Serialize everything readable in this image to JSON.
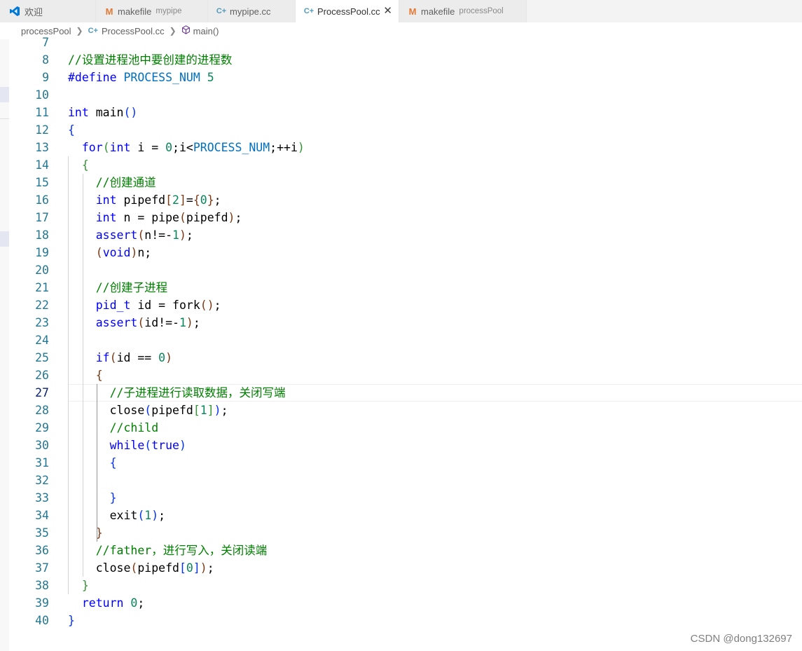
{
  "tabs": [
    {
      "label": "欢迎",
      "description": "",
      "icon": "vscode-icon",
      "active": false
    },
    {
      "label": "makefile",
      "description": "mypipe",
      "icon": "makefile-icon",
      "active": false
    },
    {
      "label": "mypipe.cc",
      "description": "",
      "icon": "cpp-file-icon",
      "active": false
    },
    {
      "label": "ProcessPool.cc",
      "description": "",
      "icon": "cpp-file-icon",
      "active": true
    },
    {
      "label": "makefile",
      "description": "processPool",
      "icon": "makefile-icon",
      "active": false
    }
  ],
  "breadcrumb": {
    "folder": "processPool",
    "file": "ProcessPool.cc",
    "symbol": "main()"
  },
  "editor": {
    "current_line": 27,
    "lines": [
      {
        "n": "7",
        "tokens": []
      },
      {
        "n": "8",
        "tokens": [
          [
            "cm",
            "//设置进程池中要创建的进程数"
          ]
        ]
      },
      {
        "n": "9",
        "tokens": [
          [
            "pp",
            "#define"
          ],
          [
            "",
            " "
          ],
          [
            "mc",
            "PROCESS_NUM"
          ],
          [
            "",
            " "
          ],
          [
            "nm",
            "5"
          ]
        ]
      },
      {
        "n": "10",
        "tokens": []
      },
      {
        "n": "11",
        "tokens": [
          [
            "kw",
            "int"
          ],
          [
            "",
            " main"
          ],
          [
            "b1",
            "()"
          ]
        ]
      },
      {
        "n": "12",
        "tokens": [
          [
            "b1",
            "{"
          ]
        ]
      },
      {
        "n": "13",
        "tokens": [
          [
            "",
            "  "
          ],
          [
            "kw",
            "for"
          ],
          [
            "b2",
            "("
          ],
          [
            "kw",
            "int"
          ],
          [
            "",
            " i = "
          ],
          [
            "nm",
            "0"
          ],
          [
            "",
            ";i<"
          ],
          [
            "mc",
            "PROCESS_NUM"
          ],
          [
            "",
            ";++i"
          ],
          [
            "b2",
            ")"
          ]
        ]
      },
      {
        "n": "14",
        "tokens": [
          [
            "",
            "  "
          ],
          [
            "b2",
            "{"
          ]
        ]
      },
      {
        "n": "15",
        "tokens": [
          [
            "",
            "    "
          ],
          [
            "cm",
            "//创建通道"
          ]
        ]
      },
      {
        "n": "16",
        "tokens": [
          [
            "",
            "    "
          ],
          [
            "kw",
            "int"
          ],
          [
            "",
            " pipefd"
          ],
          [
            "b3",
            "["
          ],
          [
            "nm",
            "2"
          ],
          [
            "b3",
            "]"
          ],
          [
            "",
            "="
          ],
          [
            "b3",
            "{"
          ],
          [
            "nm",
            "0"
          ],
          [
            "b3",
            "}"
          ],
          [
            "",
            ";"
          ]
        ]
      },
      {
        "n": "17",
        "tokens": [
          [
            "",
            "    "
          ],
          [
            "kw",
            "int"
          ],
          [
            "",
            " n = pipe"
          ],
          [
            "b3",
            "("
          ],
          [
            "",
            "pipefd"
          ],
          [
            "b3",
            ")"
          ],
          [
            "",
            ";"
          ]
        ]
      },
      {
        "n": "18",
        "tokens": [
          [
            "",
            "    "
          ],
          [
            "kw",
            "assert"
          ],
          [
            "b3",
            "("
          ],
          [
            "",
            "n!=-"
          ],
          [
            "nm",
            "1"
          ],
          [
            "b3",
            ")"
          ],
          [
            "",
            ";"
          ]
        ]
      },
      {
        "n": "19",
        "tokens": [
          [
            "",
            "    "
          ],
          [
            "b3",
            "("
          ],
          [
            "kw",
            "void"
          ],
          [
            "b3",
            ")"
          ],
          [
            "",
            "n;"
          ]
        ]
      },
      {
        "n": "20",
        "tokens": []
      },
      {
        "n": "21",
        "tokens": [
          [
            "",
            "    "
          ],
          [
            "cm",
            "//创建子进程"
          ]
        ]
      },
      {
        "n": "22",
        "tokens": [
          [
            "",
            "    "
          ],
          [
            "kw",
            "pid_t"
          ],
          [
            "",
            " id = fork"
          ],
          [
            "b3",
            "()"
          ],
          [
            "",
            ";"
          ]
        ]
      },
      {
        "n": "23",
        "tokens": [
          [
            "",
            "    "
          ],
          [
            "kw",
            "assert"
          ],
          [
            "b3",
            "("
          ],
          [
            "",
            "id!=-"
          ],
          [
            "nm",
            "1"
          ],
          [
            "b3",
            ")"
          ],
          [
            "",
            ";"
          ]
        ]
      },
      {
        "n": "24",
        "tokens": []
      },
      {
        "n": "25",
        "tokens": [
          [
            "",
            "    "
          ],
          [
            "kw",
            "if"
          ],
          [
            "b3",
            "("
          ],
          [
            "",
            "id == "
          ],
          [
            "nm",
            "0"
          ],
          [
            "b3",
            ")"
          ]
        ]
      },
      {
        "n": "26",
        "tokens": [
          [
            "",
            "    "
          ],
          [
            "b3",
            "{"
          ]
        ]
      },
      {
        "n": "27",
        "tokens": [
          [
            "",
            "      "
          ],
          [
            "cm",
            "//子进程进行读取数据，关闭写端"
          ]
        ]
      },
      {
        "n": "28",
        "tokens": [
          [
            "",
            "      close"
          ],
          [
            "b1",
            "("
          ],
          [
            "",
            "pipefd"
          ],
          [
            "b2",
            "["
          ],
          [
            "nm",
            "1"
          ],
          [
            "b2",
            "]"
          ],
          [
            "b1",
            ")"
          ],
          [
            "",
            ";"
          ]
        ]
      },
      {
        "n": "29",
        "tokens": [
          [
            "",
            "      "
          ],
          [
            "cm",
            "//child"
          ]
        ]
      },
      {
        "n": "30",
        "tokens": [
          [
            "",
            "      "
          ],
          [
            "kw",
            "while"
          ],
          [
            "b1",
            "("
          ],
          [
            "kw",
            "true"
          ],
          [
            "b1",
            ")"
          ]
        ]
      },
      {
        "n": "31",
        "tokens": [
          [
            "",
            "      "
          ],
          [
            "b1",
            "{"
          ]
        ]
      },
      {
        "n": "32",
        "tokens": []
      },
      {
        "n": "33",
        "tokens": [
          [
            "",
            "      "
          ],
          [
            "b1",
            "}"
          ]
        ]
      },
      {
        "n": "34",
        "tokens": [
          [
            "",
            "      exit"
          ],
          [
            "b1",
            "("
          ],
          [
            "nm",
            "1"
          ],
          [
            "b1",
            ")"
          ],
          [
            "",
            ";"
          ]
        ]
      },
      {
        "n": "35",
        "tokens": [
          [
            "",
            "    "
          ],
          [
            "b3",
            "}"
          ]
        ]
      },
      {
        "n": "36",
        "tokens": [
          [
            "",
            "    "
          ],
          [
            "cm",
            "//father，进行写入，关闭读端"
          ]
        ]
      },
      {
        "n": "37",
        "tokens": [
          [
            "",
            "    close"
          ],
          [
            "b3",
            "("
          ],
          [
            "",
            "pipefd"
          ],
          [
            "b1",
            "["
          ],
          [
            "nm",
            "0"
          ],
          [
            "b1",
            "]"
          ],
          [
            "b3",
            ")"
          ],
          [
            "",
            ";"
          ]
        ]
      },
      {
        "n": "38",
        "tokens": [
          [
            "",
            "  "
          ],
          [
            "b2",
            "}"
          ]
        ]
      },
      {
        "n": "39",
        "tokens": [
          [
            "",
            "  "
          ],
          [
            "kw",
            "return"
          ],
          [
            "",
            " "
          ],
          [
            "nm",
            "0"
          ],
          [
            "",
            ";"
          ]
        ]
      },
      {
        "n": "40",
        "tokens": [
          [
            "b1",
            "}"
          ]
        ]
      }
    ]
  },
  "watermark": "CSDN @dong132697"
}
